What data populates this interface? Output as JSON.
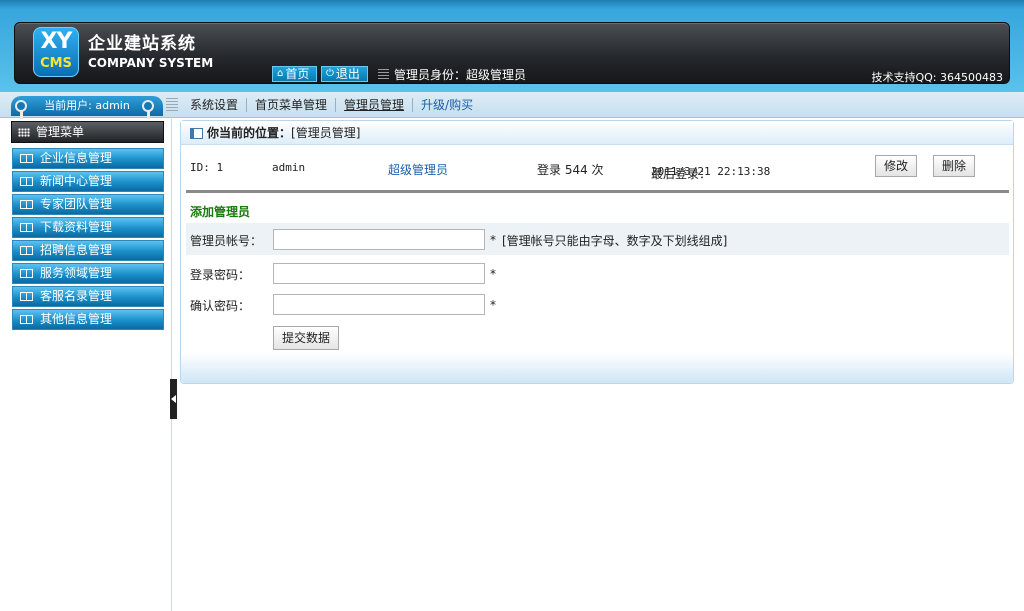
{
  "header": {
    "logo_xy": "XY",
    "logo_cms": "CMS",
    "logo_cn": "企业建站系统",
    "logo_en": "COMPANY SYSTEM",
    "home_label": "首页",
    "exit_label": "退出",
    "admin_role": "管理员身份：超级管理员",
    "support": "技术支持QQ: 364500483"
  },
  "nav": {
    "current_user": "当前用户: admin",
    "items": [
      {
        "label": "系统设置"
      },
      {
        "label": "首页菜单管理"
      },
      {
        "label": "管理员管理"
      },
      {
        "label": "升级/购买"
      }
    ]
  },
  "sidebar": {
    "title": "管理菜单",
    "items": [
      {
        "label": "企业信息管理"
      },
      {
        "label": "新闻中心管理"
      },
      {
        "label": "专家团队管理"
      },
      {
        "label": "下载资料管理"
      },
      {
        "label": "招聘信息管理"
      },
      {
        "label": "服务领域管理"
      },
      {
        "label": "客服名录管理"
      },
      {
        "label": "其他信息管理"
      }
    ]
  },
  "main": {
    "location_label": "你当前的位置：",
    "location_value": "[管理员管理]",
    "admin": {
      "id": "ID: 1",
      "name": "admin",
      "role": "超级管理员",
      "login_count": "登录 544 次",
      "last_login_label": "最后登录：",
      "last_login_value": "2011/3/21 22:13:38",
      "edit_label": "修改",
      "delete_label": "删除"
    },
    "form": {
      "title": "添加管理员",
      "account_label": "管理员帐号：",
      "account_hint": "[管理帐号只能由字母、数字及下划线组成]",
      "password_label": "登录密码：",
      "confirm_label": "确认密码：",
      "required_mark": "*",
      "account_value": "",
      "password_value": "",
      "confirm_value": "",
      "submit_label": "提交数据"
    }
  },
  "colors": {
    "header_blue": "#36a6dc",
    "header_dark": "#26292d",
    "menu_blue": "#1a8ec9",
    "link_blue": "#1a5ea9",
    "form_title_green": "#1a7a0e"
  }
}
